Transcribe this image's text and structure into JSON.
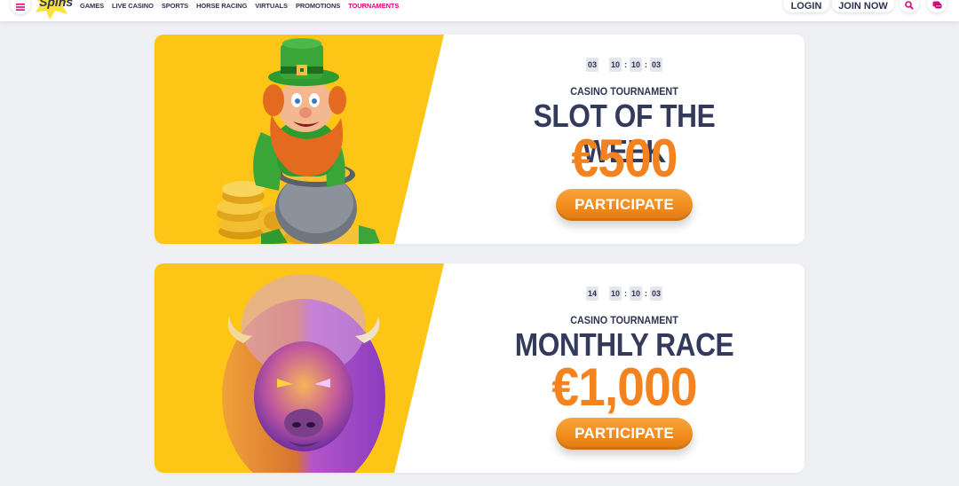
{
  "header": {
    "menu_icon": "hamburger-icon",
    "logo_text": "Spins",
    "nav": [
      "GAMES",
      "LIVE CASINO",
      "SPORTS",
      "HORSE RACING",
      "VIRTUALS",
      "PROMOTIONS",
      "TOURNAMENTS"
    ],
    "active_nav": "TOURNAMENTS",
    "login_label": "LOGIN",
    "join_label": "JOIN NOW",
    "search_icon": "search-icon",
    "chat_icon": "chat-icon"
  },
  "tournaments": [
    {
      "timer": {
        "days": "03",
        "hours": "10",
        "minutes": "10",
        "seconds": "03"
      },
      "subtitle": "CASINO TOURNAMENT",
      "title": "SLOT OF THE WEEK",
      "prize": "€500",
      "button_label": "PARTICIPATE",
      "image": "leprechaun-with-gold-pot"
    },
    {
      "timer": {
        "days": "14",
        "hours": "10",
        "minutes": "10",
        "seconds": "03"
      },
      "subtitle": "CASINO TOURNAMENT",
      "title": "MONTHLY RACE",
      "prize": "€1,000",
      "button_label": "PARTICIPATE",
      "image": "purple-buffalo"
    }
  ],
  "colors": {
    "accent": "#e6007e",
    "banner_yellow": "#fdc515",
    "prize_orange": "#f4821f",
    "text_dark": "#2e3352",
    "background": "#eef0f4"
  }
}
